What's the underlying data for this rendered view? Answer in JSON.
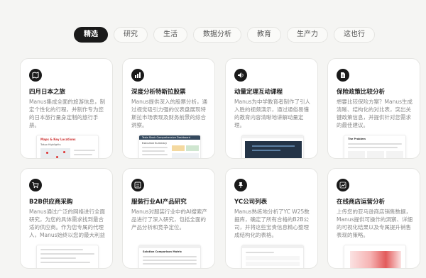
{
  "tabs": [
    "精选",
    "研究",
    "生活",
    "数据分析",
    "教育",
    "生产力",
    "这也行"
  ],
  "cards": [
    {
      "title": "四月日本之旅",
      "desc": "Manus集成全面的旅游信息，制定个性化的行程，并制作专为您的日本旅行量身定制的旅行手册。",
      "icon": "map-icon",
      "preview_title": "Maps & Key Locations",
      "preview_sub": "Tokyo Highlights"
    },
    {
      "title": "深度分析特斯拉股票",
      "desc": "Manus提供深入的股票分析，通过视觉吸引力强的仪表盘展现特斯拉市场表现及财务前景的综合洞察。",
      "icon": "chart-icon",
      "preview_title": "Tesla Stock Comprehensive Dashboard",
      "preview_sub": "Executive Summary"
    },
    {
      "title": "动量定理互动课程",
      "desc": "Manus为中学教育者制作了引人入胜的视频演示，通过通俗易懂的教育内容清晰地讲解动量定理。",
      "icon": "speaker-icon",
      "preview_title": "",
      "preview_sub": ""
    },
    {
      "title": "保险政策比较分析",
      "desc": "想要比较保险方案？Manus生成清晰、结构化的对比表，突出关键政策信息，并提供针对您需求的最佳建议。",
      "icon": "document-icon",
      "preview_title": "The Problem",
      "preview_sub": ""
    },
    {
      "title": "B2B供应商采购",
      "desc": "Manus通过广泛的网络进行全面研究，为您的具体需求找到最合适的供应商。作为您专属的代理人，Manus始终以您的最大利益为准。",
      "icon": "cart-icon",
      "preview_title": "",
      "preview_sub": ""
    },
    {
      "title": "服装行业AI产品研究",
      "desc": "Manus对服装行业中的AI搜索产品进行了深入研究，包括全面的产品分析和竞争定位。",
      "icon": "list-icon",
      "preview_title": "Solution Comparison Matrix",
      "preview_sub": ""
    },
    {
      "title": "YC公司列表",
      "desc": "Manus熟练地分析了YC W25数据库，确定了所有合格的B2B公司，并将这些宝贵信息精心整理成结构化的表格。",
      "icon": "pin-icon",
      "preview_title": "",
      "preview_sub": ""
    },
    {
      "title": "在线商店运营分析",
      "desc": "上传您的亚马逊商店销售数据，Manus提供可操作的洞察、详细的可视化结果以及专属提升销售表现的策略。",
      "icon": "trend-icon",
      "preview_title": "",
      "preview_sub": ""
    }
  ],
  "colors": {
    "accent": "#1a1a1a",
    "muted_text": "#888888",
    "background": "#f5f5f3"
  }
}
